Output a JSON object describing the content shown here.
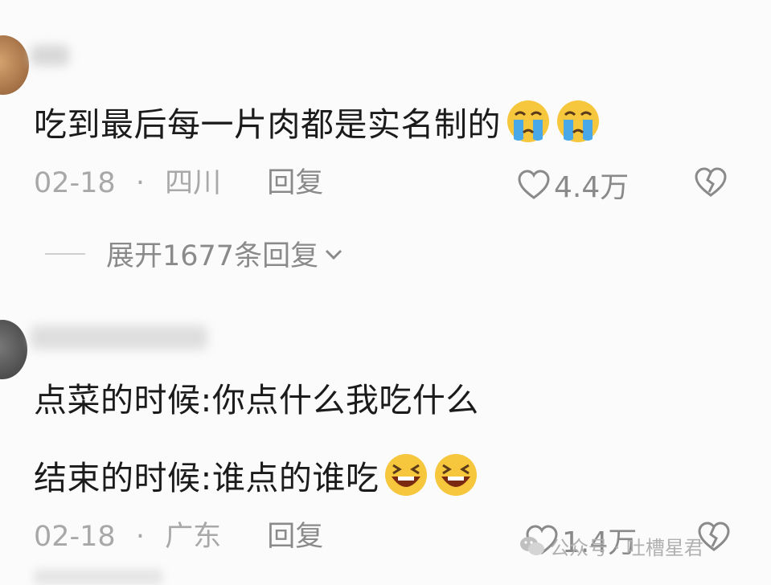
{
  "comments": [
    {
      "text": "吃到最后每一片肉都是实名制的",
      "emojis": [
        "crying-face-icon",
        "crying-face-icon"
      ],
      "date": "02-18",
      "separator": "·",
      "location": "四川",
      "reply_label": "回复",
      "likes": "4.4万",
      "expand_label": "展开1677条回复"
    },
    {
      "line1": "点菜的时候:你点什么我吃什么",
      "line2": "结束的时候:谁点的谁吃",
      "emojis": [
        "laughing-face-icon",
        "laughing-face-icon"
      ],
      "date": "02-18",
      "separator": "·",
      "location": "广东",
      "reply_label": "回复",
      "likes": "1.4万"
    }
  ],
  "watermark": {
    "text": "公众号 · 吐槽星君",
    "icon": "wechat-icon"
  },
  "colors": {
    "background": "#fbfbfb",
    "text": "#1b1b1b",
    "meta": "#a8a8a8",
    "emoji_yellow": "#f6c63c",
    "tear_blue": "#49a9e8"
  }
}
